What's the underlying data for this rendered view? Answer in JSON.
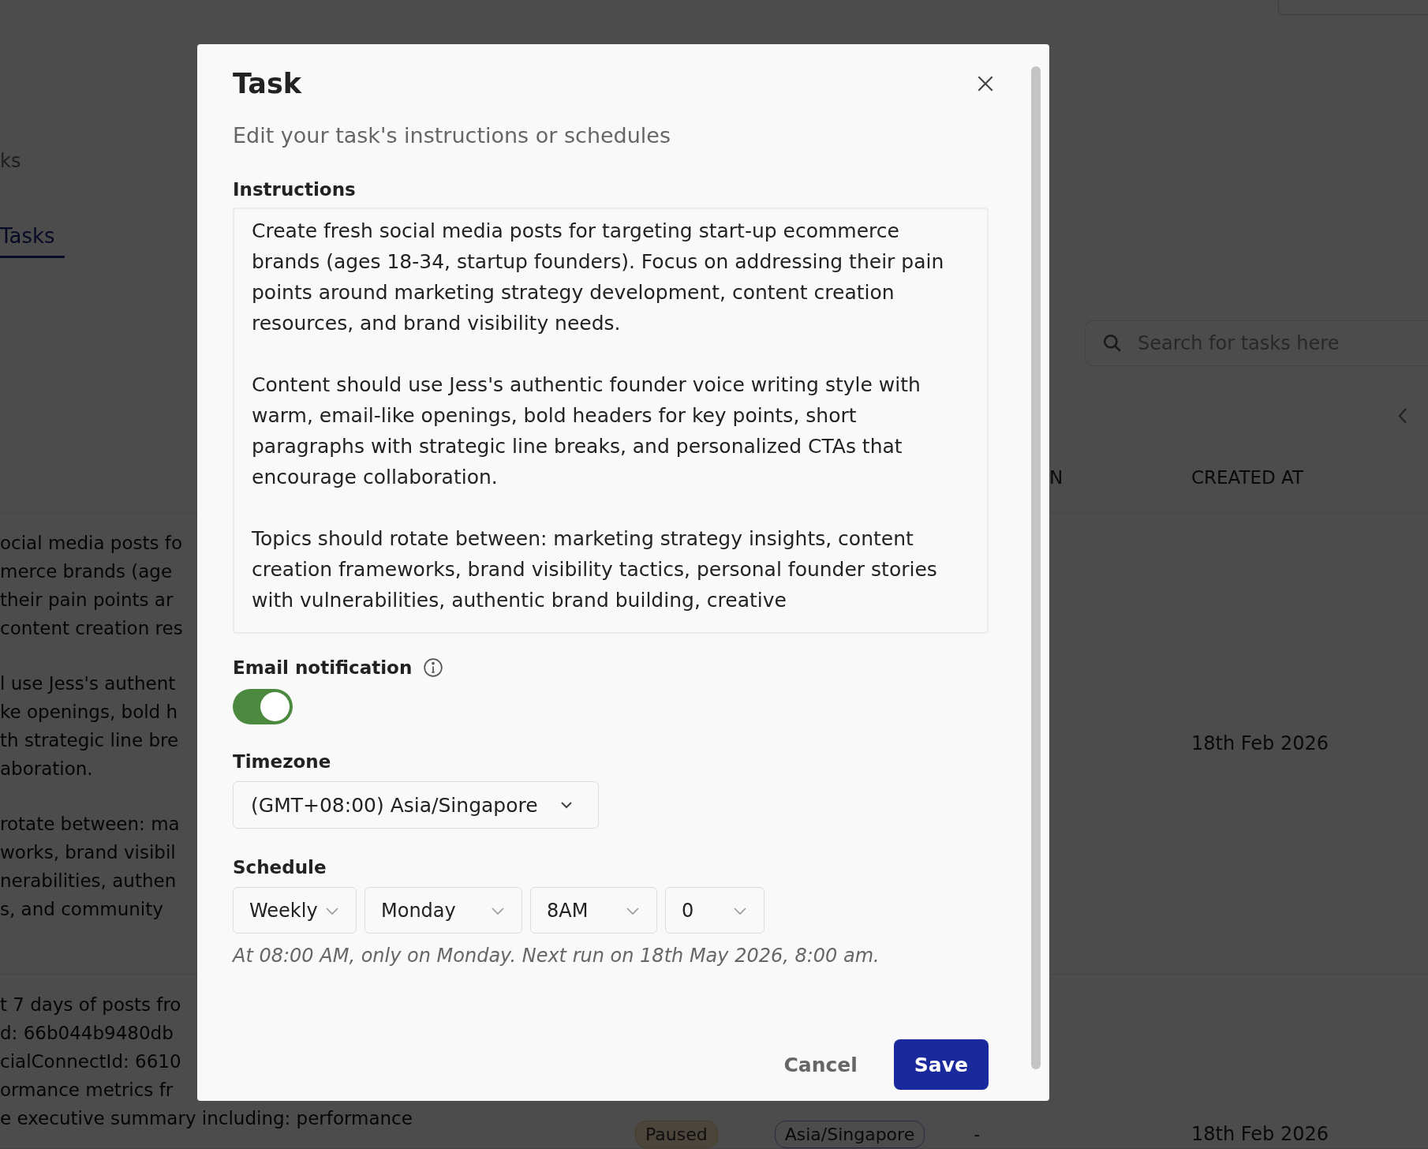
{
  "background": {
    "breadcrumb_partial": "ks",
    "tabs": [
      {
        "label": "Tasks",
        "selected": true
      }
    ],
    "search": {
      "placeholder": "Search for tasks here"
    },
    "table": {
      "columns": [
        {
          "label": "N"
        },
        {
          "label": "CREATED AT"
        }
      ],
      "rows": [
        {
          "task": [
            [
              "ocial media posts fo",
              "merce brands (age",
              "their pain points ar",
              "content creation res"
            ],
            [
              "l use Jess's authent",
              "ke openings, bold h",
              "th strategic line bre",
              "aboration."
            ],
            [
              "rotate between: ma",
              "works, brand visibil",
              "nerabilities, authen",
              "s, and community"
            ]
          ],
          "created_at": "18th Feb 2026"
        },
        {
          "task": [
            [
              "t 7 days of posts fro",
              "d: 66b044b9480db",
              "cialConnectId: 6610",
              "ormance metrics fr",
              "e executive summary including: performance"
            ]
          ],
          "status": {
            "label": "Paused",
            "kind": "paused"
          },
          "timezone": "Asia/Singapore",
          "schedule": "-",
          "created_at": "18th Feb 2026"
        }
      ]
    }
  },
  "dialog": {
    "title": "Task",
    "subtitle": "Edit your task's instructions or schedules",
    "instructions": {
      "label": "Instructions",
      "value": "Create fresh social media posts for targeting start-up ecommerce brands (ages 18-34, startup founders). Focus on addressing their pain points around marketing strategy development, content creation resources, and brand visibility needs.\n\nContent should use Jess's authentic founder voice writing style with warm, email-like openings, bold headers for key points, short paragraphs with strategic line breaks, and personalized CTAs that encourage collaboration.\n\nTopics should rotate between: marketing strategy insights, content creation frameworks, brand visibility tactics, personal founder stories with vulnerabilities, authentic brand building, creative"
    },
    "email_notification": {
      "label": "Email notification",
      "on": true
    },
    "timezone": {
      "label": "Timezone",
      "value": "(GMT+08:00) Asia/Singapore"
    },
    "schedule": {
      "label": "Schedule",
      "fields": [
        "Weekly",
        "Monday",
        "8AM",
        "0"
      ],
      "summary": "At 08:00 AM, only on Monday. Next run on 18th May 2026, 8:00 am."
    },
    "buttons": [
      {
        "label": "Cancel",
        "kind": "secondary"
      },
      {
        "label": "Save",
        "kind": "primary"
      }
    ]
  }
}
